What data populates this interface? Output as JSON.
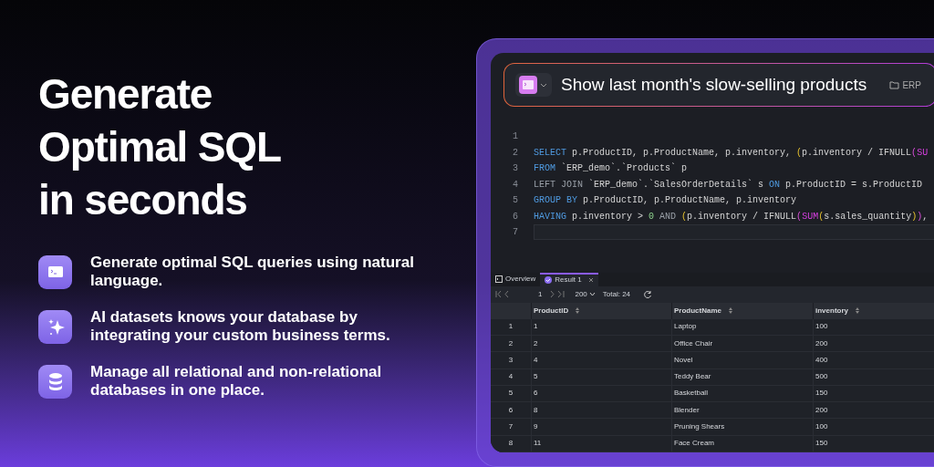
{
  "headline": [
    "Generate",
    "Optimal SQL",
    "in seconds"
  ],
  "features": [
    {
      "kind": "terminal",
      "text": "Generate optimal SQL queries using natural language."
    },
    {
      "kind": "sparkle",
      "text": "AI datasets knows your database by integrating your custom business terms."
    },
    {
      "kind": "database",
      "text": "Manage all relational and non-relational databases in one place."
    }
  ],
  "prompt": {
    "text": "Show last month's slow-selling products",
    "database": "ERP"
  },
  "code_lines": [
    {
      "number": "1"
    },
    {
      "number": "2",
      "tokens": [
        {
          "kind": "keyword",
          "text": "SELECT"
        },
        {
          "kind": "plain",
          "text": " p.ProductID, p.ProductName, p.inventory, "
        },
        {
          "kind": "paren",
          "text": "("
        },
        {
          "kind": "plain",
          "text": "p.inventory / IFNULL"
        },
        {
          "kind": "paren2",
          "text": "("
        },
        {
          "kind": "func",
          "text": "SU"
        }
      ]
    },
    {
      "number": "3",
      "tokens": [
        {
          "kind": "keyword",
          "text": "FROM"
        },
        {
          "kind": "plain",
          "text": " `ERP_demo`.`Products` p"
        }
      ]
    },
    {
      "number": "4",
      "tokens": [
        {
          "kind": "muted",
          "text": "LEFT JOIN"
        },
        {
          "kind": "plain",
          "text": " `ERP_demo`.`SalesOrderDetails` s "
        },
        {
          "kind": "keyword",
          "text": "ON"
        },
        {
          "kind": "plain",
          "text": " p.ProductID = s.ProductID"
        }
      ]
    },
    {
      "number": "5",
      "tokens": [
        {
          "kind": "keyword",
          "text": "GROUP BY"
        },
        {
          "kind": "plain",
          "text": " p.ProductID, p.ProductName, p.inventory"
        }
      ]
    },
    {
      "number": "6",
      "tokens": [
        {
          "kind": "keyword",
          "text": "HAVING"
        },
        {
          "kind": "plain",
          "text": " p.inventory > "
        },
        {
          "kind": "number",
          "text": "0"
        },
        {
          "kind": "muted",
          "text": " AND "
        },
        {
          "kind": "paren",
          "text": "("
        },
        {
          "kind": "plain",
          "text": "p.inventory / IFNULL"
        },
        {
          "kind": "paren2",
          "text": "("
        },
        {
          "kind": "func",
          "text": "SUM"
        },
        {
          "kind": "paren",
          "text": "("
        },
        {
          "kind": "plain",
          "text": "s.sales_quantity"
        },
        {
          "kind": "paren",
          "text": ")"
        },
        {
          "kind": "paren2",
          "text": ")"
        },
        {
          "kind": "plain",
          "text": ","
        }
      ]
    },
    {
      "number": "7"
    }
  ],
  "result_tabs": [
    {
      "kind": "overview",
      "label": "Overview",
      "selected": false
    },
    {
      "kind": "result",
      "label": "Result 1",
      "selected": true
    }
  ],
  "pager": {
    "page": "1",
    "page_size": "200",
    "total_label": "Total:",
    "total": "24"
  },
  "table": {
    "columns": [
      "ProductID",
      "ProductName",
      "inventory"
    ],
    "rows": [
      {
        "index": "1",
        "cells": [
          "1",
          "Laptop",
          "100"
        ]
      },
      {
        "index": "2",
        "cells": [
          "2",
          "Office Chair",
          "200"
        ]
      },
      {
        "index": "3",
        "cells": [
          "4",
          "Novel",
          "400"
        ]
      },
      {
        "index": "4",
        "cells": [
          "5",
          "Teddy Bear",
          "500"
        ]
      },
      {
        "index": "5",
        "cells": [
          "6",
          "Basketball",
          "150"
        ]
      },
      {
        "index": "6",
        "cells": [
          "8",
          "Blender",
          "200"
        ]
      },
      {
        "index": "7",
        "cells": [
          "9",
          "Pruning Shears",
          "100"
        ]
      },
      {
        "index": "8",
        "cells": [
          "11",
          "Face Cream",
          "150"
        ]
      }
    ]
  }
}
